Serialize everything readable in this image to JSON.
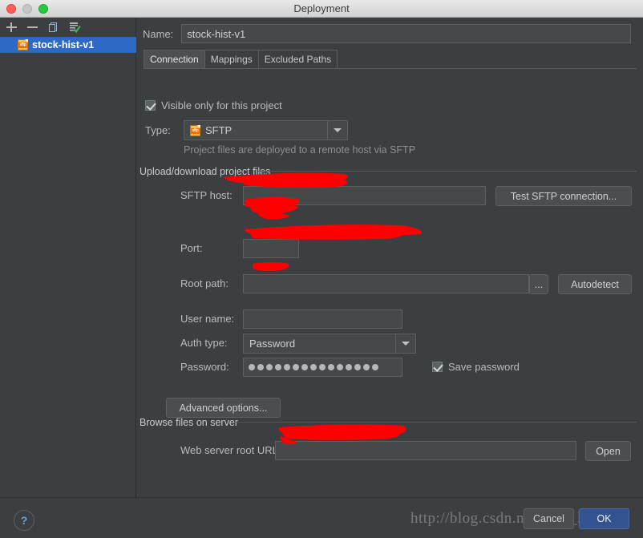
{
  "window": {
    "title": "Deployment",
    "traffic_lights": [
      "close-red",
      "minimize-gray",
      "zoom-green"
    ]
  },
  "sidebar": {
    "toolbar": [
      {
        "name": "add",
        "glyph": "+"
      },
      {
        "name": "remove",
        "glyph": "−"
      },
      {
        "name": "copy",
        "glyph": "copy-icon"
      },
      {
        "name": "set-default",
        "glyph": "set-default-icon"
      }
    ],
    "items": [
      {
        "label": "stock-hist-v1",
        "icon": "sftp",
        "icon_text": "sftp",
        "selected": true
      }
    ]
  },
  "form": {
    "name_label": "Name:",
    "name_value": "stock-hist-v1",
    "tabs": [
      {
        "label": "Connection",
        "active": true
      },
      {
        "label": "Mappings",
        "active": false
      },
      {
        "label": "Excluded Paths",
        "active": false
      }
    ],
    "visible_only_label": "Visible only for this project",
    "visible_only_checked": true,
    "type_label": "Type:",
    "type_value": "SFTP",
    "type_icon_text": "sftp",
    "type_hint": "Project files are deployed to a remote host via SFTP",
    "upload_group_label": "Upload/download project files",
    "sftp_host_label": "SFTP host:",
    "sftp_host_value": "",
    "test_connection_label": "Test SFTP connection...",
    "port_label": "Port:",
    "port_value": "",
    "root_path_label": "Root path:",
    "root_path_value": "",
    "browse_button_label": "...",
    "autodetect_label": "Autodetect",
    "user_name_label": "User name:",
    "user_name_value": "",
    "auth_type_label": "Auth type:",
    "auth_type_value": "Password",
    "password_label": "Password:",
    "password_dots": 15,
    "save_password_label": "Save password",
    "save_password_checked": true,
    "advanced_options_label": "Advanced options...",
    "browse_group_label": "Browse files on server",
    "web_root_label": "Web server root URL:",
    "web_root_value": "",
    "open_label": "Open"
  },
  "footer": {
    "help_label": "?",
    "cancel_label": "Cancel",
    "ok_label": "OK",
    "watermark": "http://blog.csdn.net/ping_hu"
  },
  "colors": {
    "background": "#3c3f41",
    "selection": "#2d6ac7",
    "field": "#45494a",
    "redaction": "#fe0000",
    "ok_button": "#32538f"
  }
}
